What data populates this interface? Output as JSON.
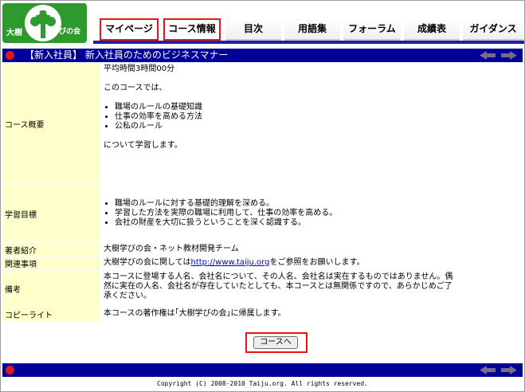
{
  "logo": {
    "left_text": "大樹",
    "right_text": "学びの会"
  },
  "nav": [
    {
      "label": "マイページ",
      "highlighted": true
    },
    {
      "label": "コース情報",
      "highlighted": true
    },
    {
      "label": "目次",
      "highlighted": false
    },
    {
      "label": "用語集",
      "highlighted": false
    },
    {
      "label": "フォーラム",
      "highlighted": false
    },
    {
      "label": "成績表",
      "highlighted": false
    },
    {
      "label": "ガイダンス",
      "highlighted": false
    }
  ],
  "title_bar": {
    "title": "【新入社員】 新入社員のためのビジネスマナー"
  },
  "course": {
    "overview_label": "コース概要",
    "duration": "平均時間3時間00分",
    "intro": "このコースでは、",
    "topics": [
      "職場のルールの基礎知識",
      "仕事の効率を高める方法",
      "公私のルール"
    ],
    "outro": "について学習します。",
    "goals_label": "学習目標",
    "goals": [
      "職場のルールに対する基礎的理解を深める。",
      "学習した方法を実際の職場に利用して、仕事の効率を高める。",
      "会社の財産を大切に扱うということを深く認識する。"
    ],
    "author_label": "著者紹介",
    "author": "大樹学びの会・ネット教材開発チーム",
    "related_label": "関連事項",
    "related_prefix": "大樹学びの会に関しては",
    "related_link": "http://www.taiju.org",
    "related_suffix": "をご参照をお願いします。",
    "notes_label": "備考",
    "notes": "本コースに登場する人名、会社名について、その人名、会社名は実在するものではありません。偶然に実在の人名、会社名が存在していたとしても、本コースとは無関係ですので、あらかじめご了承ください。",
    "copyright_label": "コピーライト",
    "copyright": "本コースの著作権は｢大樹学びの会｣に帰属します。"
  },
  "button": {
    "label": "コースへ"
  },
  "footer": {
    "copyright": "Copyright (C) 2008-2010 Taiju.org. All rights reserved."
  },
  "colors": {
    "bar": "#000099",
    "label_bg": "#ffffcc",
    "highlight": "#e01818",
    "logo": "#2e9a2e"
  }
}
